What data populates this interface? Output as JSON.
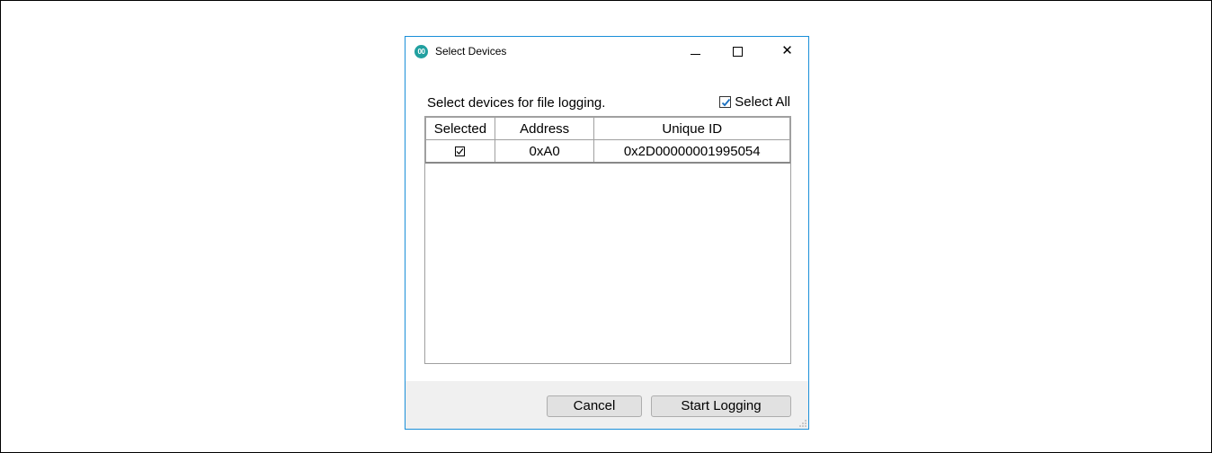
{
  "window": {
    "title": "Select Devices",
    "app_icon_label": "00",
    "close_glyph": "✕"
  },
  "content": {
    "instruction": "Select devices for file logging.",
    "select_all": {
      "label": "Select All",
      "checked": true
    }
  },
  "table": {
    "columns": [
      "Selected",
      "Address",
      "Unique ID"
    ],
    "rows": [
      {
        "selected": true,
        "address": "0xA0",
        "unique_id": "0x2D00000001995054"
      }
    ]
  },
  "footer": {
    "cancel_label": "Cancel",
    "start_label": "Start Logging"
  },
  "colors": {
    "window_border": "#1a8fd8",
    "app_icon": "#21a0a0",
    "check_accent": "#1a6fbf"
  }
}
